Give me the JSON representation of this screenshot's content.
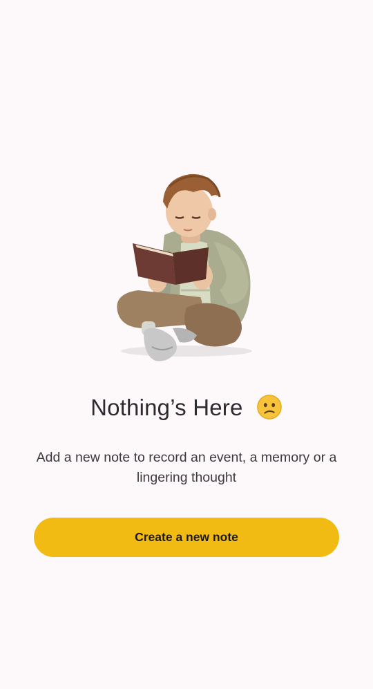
{
  "empty_state": {
    "illustration": "boy-reading-book-illustration",
    "title": "Nothing’s Here",
    "title_emoji": "confused-face-emoji",
    "description": "Add a new note to record an event, a memory or a lingering thought",
    "cta_label": "Create a new note"
  },
  "colors": {
    "background": "#fdf9fb",
    "accent": "#f2bb13",
    "text_primary": "#2c2b30",
    "text_secondary": "#3a393e"
  }
}
